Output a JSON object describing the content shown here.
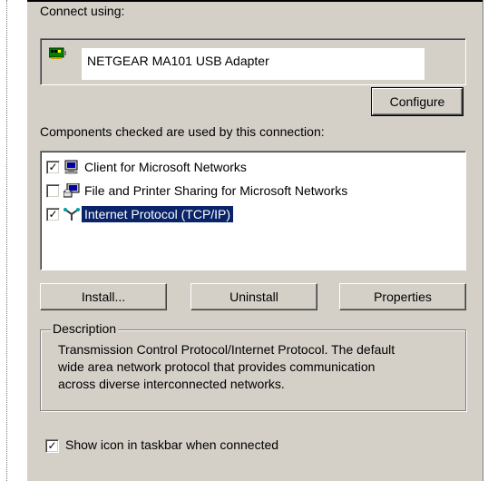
{
  "connect_using": {
    "label": "Connect using:",
    "adapter_name": "NETGEAR MA101 USB Adapter",
    "adapter_icon": "network-card-icon"
  },
  "configure_button": "Configure",
  "components": {
    "label": "Components checked are used by this connection:",
    "items": [
      {
        "label": "Client for Microsoft Networks",
        "checked": true,
        "icon": "network-client-icon",
        "selected": false
      },
      {
        "label": "File and Printer Sharing for Microsoft Networks",
        "checked": false,
        "icon": "file-printer-sharing-icon",
        "selected": false
      },
      {
        "label": "Internet Protocol (TCP/IP)",
        "checked": true,
        "icon": "protocol-icon",
        "selected": true
      }
    ]
  },
  "buttons": {
    "install": "Install...",
    "uninstall": "Uninstall",
    "properties": "Properties"
  },
  "description": {
    "title": "Description",
    "text_line1": "Transmission Control Protocol/Internet Protocol. The default",
    "text_line2": "wide area network protocol that provides communication",
    "text_line3": "across diverse interconnected networks."
  },
  "taskbar_option": {
    "label": "Show icon in taskbar when connected",
    "checked": true
  },
  "colors": {
    "dialog_bg": "#d4d0c8",
    "selection_bg": "#0a246a",
    "selection_fg": "#ffffff"
  }
}
